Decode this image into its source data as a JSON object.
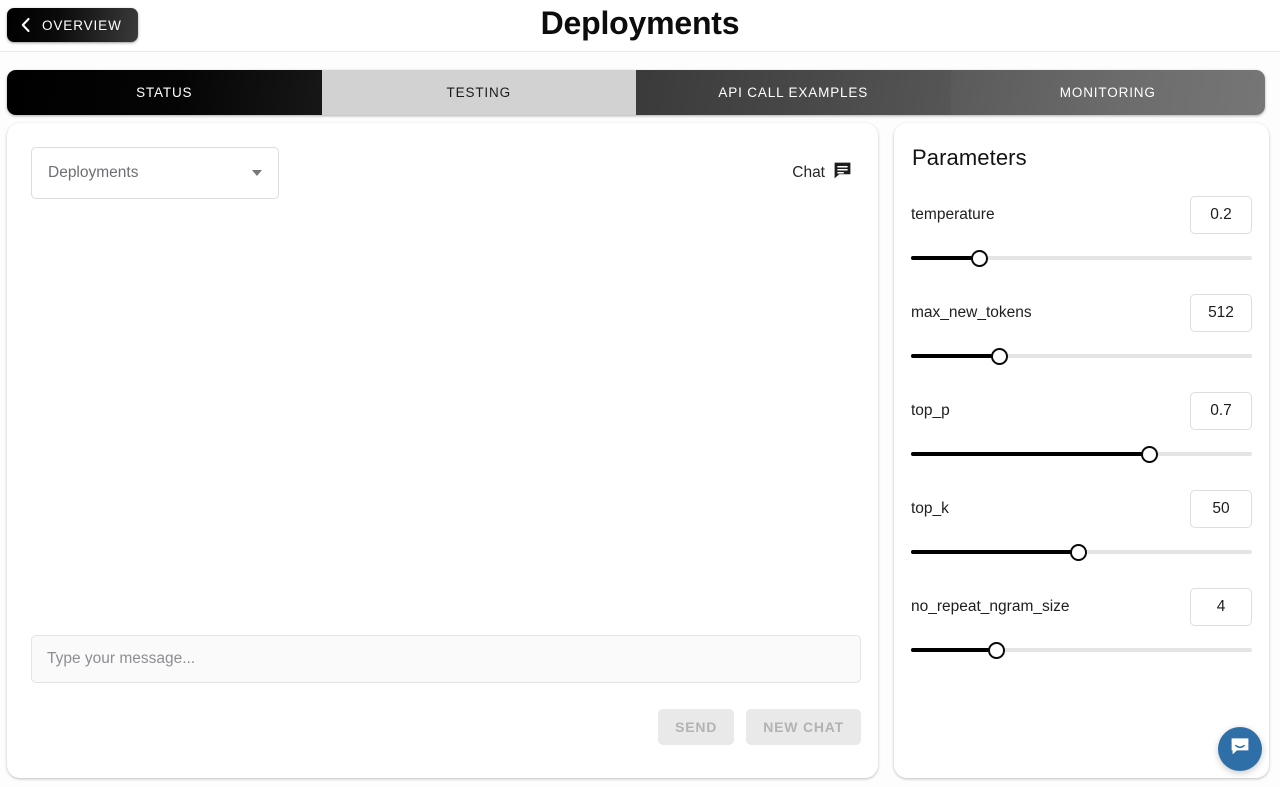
{
  "header": {
    "back_button_label": "OVERVIEW",
    "back_icon": "chevron-left-icon",
    "title": "Deployments"
  },
  "tabs": [
    {
      "label": "STATUS",
      "active": true
    },
    {
      "label": "TESTING",
      "active": false
    },
    {
      "label": "API CALL EXAMPLES",
      "active": false
    },
    {
      "label": "MONITORING",
      "active": false
    }
  ],
  "chat_panel": {
    "deployment_select": {
      "selected": "Deployments",
      "caret_icon": "caret-down-icon"
    },
    "chat_mode_label": "Chat",
    "chat_mode_icon": "chat-bubble-icon",
    "message_input": {
      "value": "",
      "placeholder": "Type your message..."
    },
    "send_button": "SEND",
    "new_chat_button": "NEW CHAT"
  },
  "parameters": {
    "title": "Parameters",
    "items": [
      {
        "name": "temperature",
        "value": "0.2",
        "percent": 20
      },
      {
        "name": "max_new_tokens",
        "value": "512",
        "percent": 26
      },
      {
        "name": "top_p",
        "value": "0.7",
        "percent": 70
      },
      {
        "name": "top_k",
        "value": "50",
        "percent": 49
      },
      {
        "name": "no_repeat_ngram_size",
        "value": "4",
        "percent": 25
      }
    ]
  },
  "launcher": {
    "icon": "intercom-chat-icon",
    "color": "#2f6fa8"
  },
  "colors": {
    "active_tab": "#000000",
    "testing_tab": "#d2d2d2",
    "slider_fill": "#000000",
    "slider_track": "#e4e4e4",
    "page_background": "#fdfdfd"
  }
}
